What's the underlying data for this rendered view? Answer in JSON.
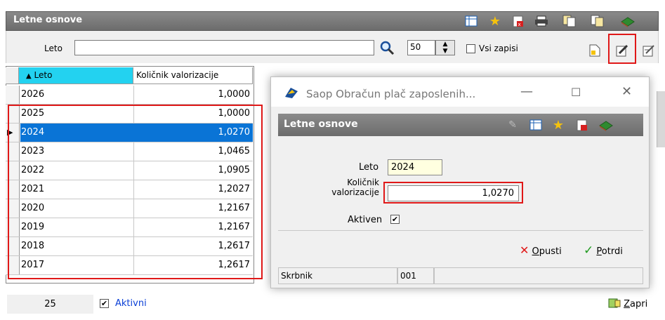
{
  "main": {
    "title": "Letne osnove",
    "filter": {
      "leto_label": "Leto",
      "leto_value": "",
      "limit_value": "50",
      "vsi_zapisi_label": "Vsi zapisi"
    },
    "grid": {
      "columns": [
        "Leto",
        "Količnik valorizacije"
      ],
      "sort_column": "Leto",
      "rows": [
        {
          "leto": "2026",
          "kolicnik": "1,0000",
          "selected": false
        },
        {
          "leto": "2025",
          "kolicnik": "1,0000",
          "selected": false
        },
        {
          "leto": "2024",
          "kolicnik": "1,0270",
          "selected": true
        },
        {
          "leto": "2023",
          "kolicnik": "1,0465",
          "selected": false
        },
        {
          "leto": "2022",
          "kolicnik": "1,0905",
          "selected": false
        },
        {
          "leto": "2021",
          "kolicnik": "1,2027",
          "selected": false
        },
        {
          "leto": "2020",
          "kolicnik": "1,2167",
          "selected": false
        },
        {
          "leto": "2019",
          "kolicnik": "1,2167",
          "selected": false
        },
        {
          "leto": "2018",
          "kolicnik": "1,2617",
          "selected": false
        },
        {
          "leto": "2017",
          "kolicnik": "1,2617",
          "selected": false
        }
      ]
    },
    "status": {
      "count": "25",
      "aktivni_label": "Aktivni",
      "zapri_label": "Zapri",
      "zapri_hotkey": "Z",
      "zapri_rest": "apri"
    },
    "toolbar_icons": [
      "table-icon",
      "star-icon",
      "delete-icon",
      "printer-icon",
      "copy-icon",
      "export-icon",
      "book-icon",
      "new-document-icon",
      "edit-icon",
      "multi-edit-icon"
    ]
  },
  "dialog": {
    "window_title": "Saop Obračun plač zaposlenih...",
    "header_title": "Letne osnove",
    "leto_label": "Leto",
    "leto_value": "2024",
    "kolicnik_label_line1": "Količnik",
    "kolicnik_label_line2": "valorizacije",
    "kolicnik_value": "1,0270",
    "aktiven_label": "Aktiven",
    "opusti_hotkey": "O",
    "opusti_rest": "pusti",
    "potrdi_hotkey": "P",
    "potrdi_rest": "otrdi",
    "status_user": "Skrbnik",
    "status_code": "001"
  },
  "colors": {
    "title_bar": "#6c6c6c",
    "selected_row": "#0a74d6",
    "sorted_header": "#23d2f0",
    "highlight": "#e01818",
    "link": "#0a3fd6",
    "input_yellow": "#ffffe0"
  }
}
